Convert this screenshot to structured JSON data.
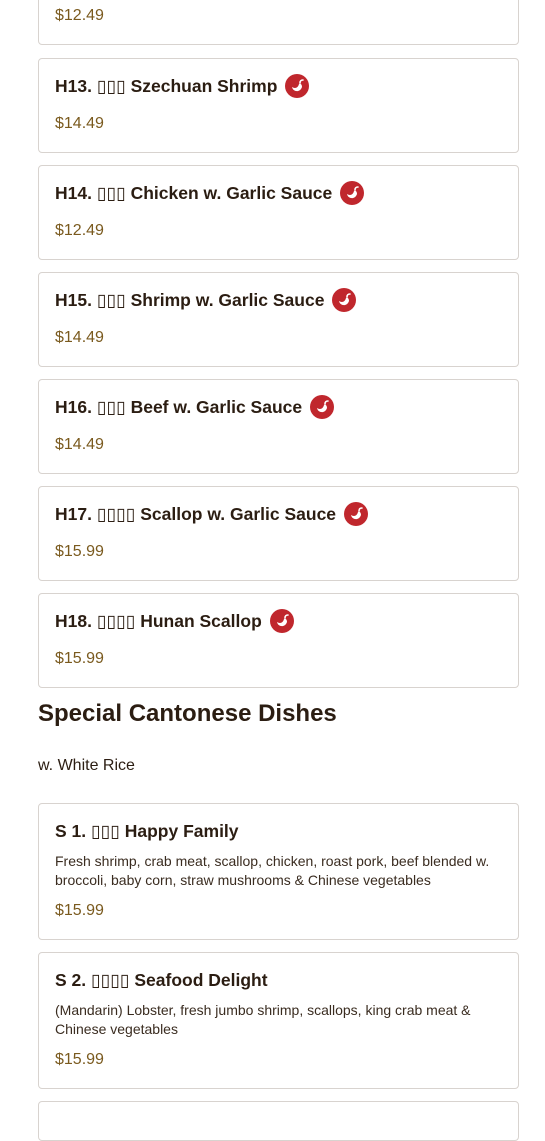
{
  "menu_items": [
    {
      "title": "",
      "price": "$12.49"
    },
    {
      "title": "H13. ▯▯▯ Szechuan Shrimp",
      "price": "$14.49",
      "spicy": true
    },
    {
      "title": "H14. ▯▯▯ Chicken w. Garlic Sauce",
      "price": "$12.49",
      "spicy": true
    },
    {
      "title": "H15. ▯▯▯ Shrimp w. Garlic Sauce",
      "price": "$14.49",
      "spicy": true
    },
    {
      "title": "H16. ▯▯▯ Beef w. Garlic Sauce",
      "price": "$14.49",
      "spicy": true
    },
    {
      "title": "H17. ▯▯▯▯ Scallop w. Garlic Sauce",
      "price": "$15.99",
      "spicy": true
    },
    {
      "title": "H18. ▯▯▯▯ Hunan Scallop",
      "price": "$15.99",
      "spicy": true
    }
  ],
  "section": {
    "title": "Special Cantonese Dishes",
    "subtitle": "w. White Rice"
  },
  "special_items": [
    {
      "title": "S 1. ▯▯▯ Happy Family",
      "description": "Fresh shrimp, crab meat, scallop, chicken, roast pork, beef blended w. broccoli, baby corn, straw mushrooms & Chinese vegetables",
      "price": "$15.99"
    },
    {
      "title": "S 2. ▯▯▯▯ Seafood Delight",
      "description": "(Mandarin) Lobster, fresh jumbo shrimp, scallops, king crab meat & Chinese vegetables",
      "price": "$15.99"
    }
  ],
  "icons": {
    "spicy": "chili-pepper-icon"
  },
  "colors": {
    "price": "#7a5a1e",
    "spicy_badge": "#c0272d"
  }
}
